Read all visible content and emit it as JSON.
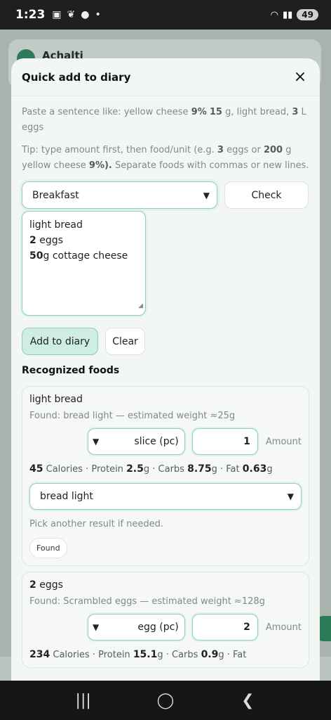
{
  "status_bar": {
    "time": "1:23",
    "battery": "49"
  },
  "background": {
    "app_name": "Achalti"
  },
  "modal": {
    "title": "Quick add to diary",
    "close_label": "×",
    "hint_parts": [
      {
        "text": "Paste a sentence like: yellow cheese ",
        "bold": false
      },
      {
        "text": "9%",
        "bold": true
      },
      {
        "text": " ",
        "bold": false
      },
      {
        "text": "15",
        "bold": true
      },
      {
        "text": " g, light bread, ",
        "bold": false
      },
      {
        "text": "3",
        "bold": true
      },
      {
        "text": " L eggs",
        "bold": false
      }
    ],
    "tip_parts": [
      {
        "text": "Tip: type amount first, then food/unit (e.g. ",
        "bold": false
      },
      {
        "text": "3",
        "bold": true
      },
      {
        "text": " eggs or ",
        "bold": false
      },
      {
        "text": "200",
        "bold": true
      },
      {
        "text": " g yellow cheese ",
        "bold": false
      },
      {
        "text": "9%).",
        "bold": true
      },
      {
        "text": " Separate foods with commas or new lines.",
        "bold": false
      }
    ],
    "meal_select": {
      "value": "Breakfast"
    },
    "check_button": "Check",
    "textarea_lines": [
      [
        {
          "text": "light bread",
          "bold": false
        }
      ],
      [
        {
          "text": "2",
          "bold": true
        },
        {
          "text": " eggs",
          "bold": false
        }
      ],
      [
        {
          "text": "50",
          "bold": true
        },
        {
          "text": "g cottage cheese",
          "bold": false
        }
      ]
    ],
    "add_button": "Add to diary",
    "clear_button": "Clear",
    "recognized_title": "Recognized foods",
    "foods": [
      {
        "title": "light bread",
        "found_text": "Found: bread light — estimated weight ≈25g",
        "unit": "slice (pc)",
        "amount": "1",
        "amount_label": "Amount",
        "calories": "45",
        "protein": "2.5",
        "carbs": "8.75",
        "fat": "0.63",
        "selected_result": "bread light",
        "pick_text": "Pick another result if needed.",
        "badge": "Found"
      },
      {
        "title": "2 eggs",
        "found_text": "Found: Scrambled eggs — estimated weight ≈128g",
        "unit": "egg (pc)",
        "amount": "2",
        "amount_label": "Amount",
        "calories": "234",
        "protein": "15.1",
        "carbs": "0.9",
        "fat": ""
      }
    ]
  }
}
